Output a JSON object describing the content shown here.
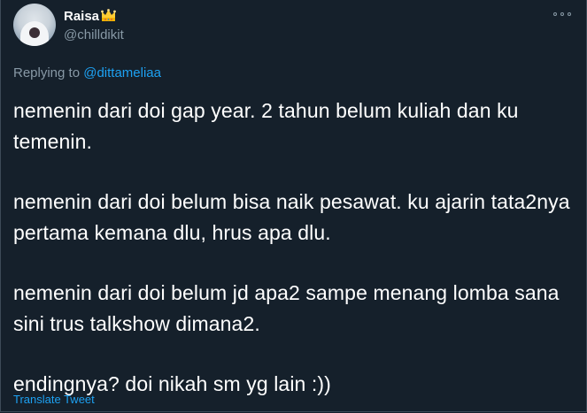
{
  "author": {
    "display_name": "Raisa",
    "handle": "@chilldikit",
    "badge_icon": "crown-icon"
  },
  "reply": {
    "prefix": "Replying to",
    "target": "@dittameliaa"
  },
  "tweet": {
    "paragraphs": [
      "nemenin dari doi gap year. 2 tahun belum kuliah dan ku temenin.",
      "nemenin dari doi belum bisa naik pesawat. ku ajarin tata2nya pertama kemana dlu, hrus apa dlu.",
      "nemenin dari doi belum jd apa2 sampe menang lomba sana sini trus talkshow dimana2.",
      "endingnya? doi nikah sm yg lain :))"
    ]
  },
  "actions": {
    "translate_label": "Translate Tweet",
    "more_icon": "more-icon"
  },
  "colors": {
    "background": "#15202b",
    "text": "#ffffff",
    "secondary": "#8899a6",
    "accent": "#1da1f2"
  }
}
